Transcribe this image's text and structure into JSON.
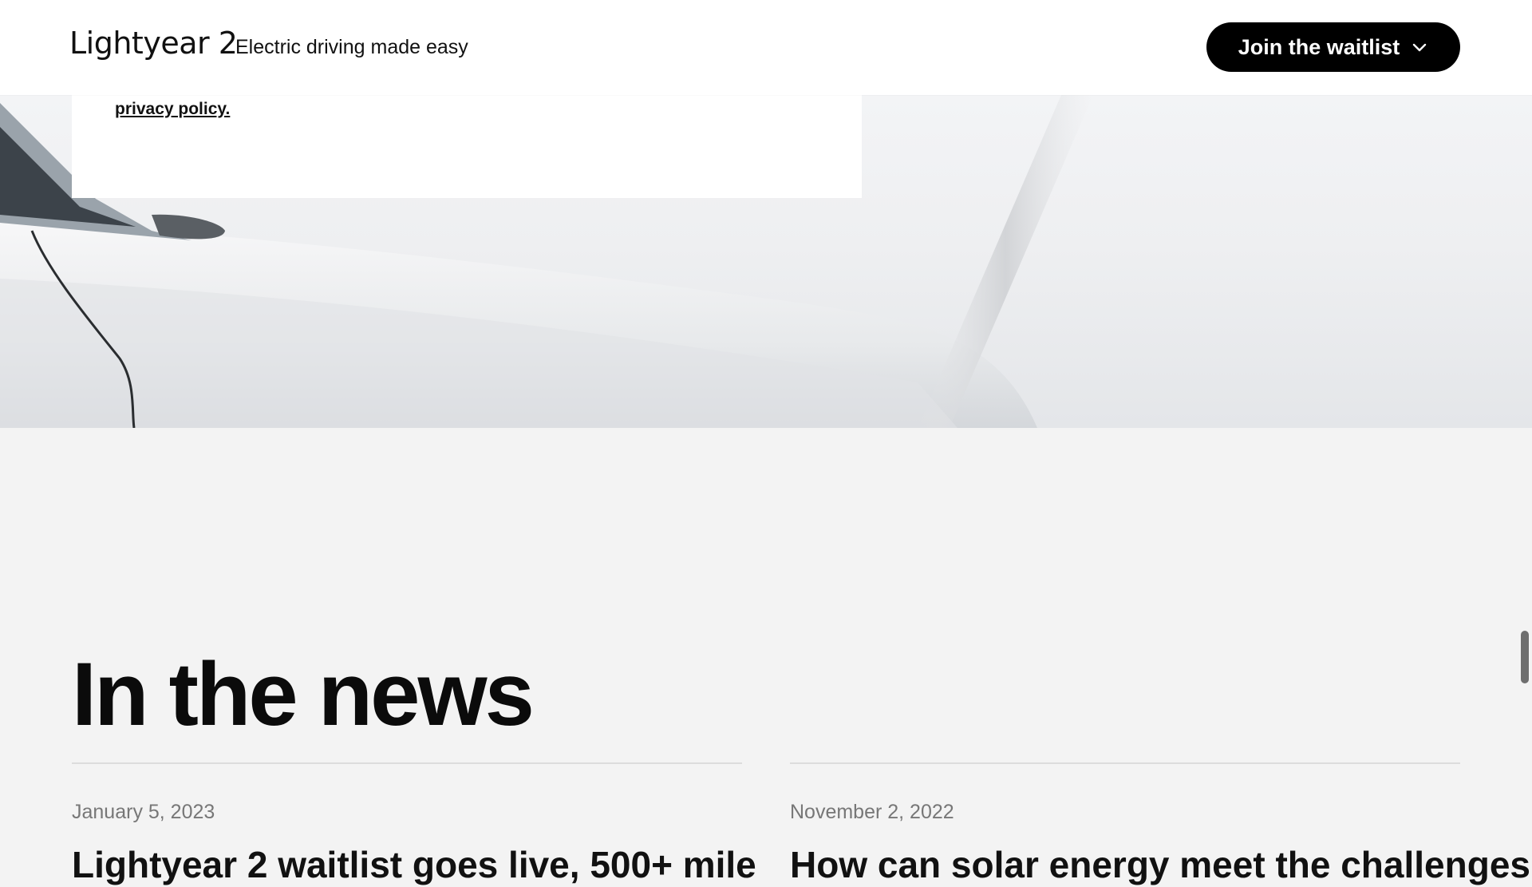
{
  "header": {
    "brand": "Lightyear 2",
    "tagline": "Electric driving made easy",
    "cta_label": "Join the waitlist"
  },
  "form_card": {
    "privacy_link": "privacy policy."
  },
  "news": {
    "title": "In the news",
    "articles": [
      {
        "date": "January 5, 2023",
        "headline": "Lightyear 2 waitlist goes live, 500+ mile"
      },
      {
        "date": "November 2, 2022",
        "headline": "How can solar energy meet the challenges"
      }
    ]
  },
  "colors": {
    "background": "#f3f3f3",
    "cta": "#000000",
    "text": "#111111"
  },
  "icons": {
    "cta_icon": "chevron-down-icon"
  }
}
